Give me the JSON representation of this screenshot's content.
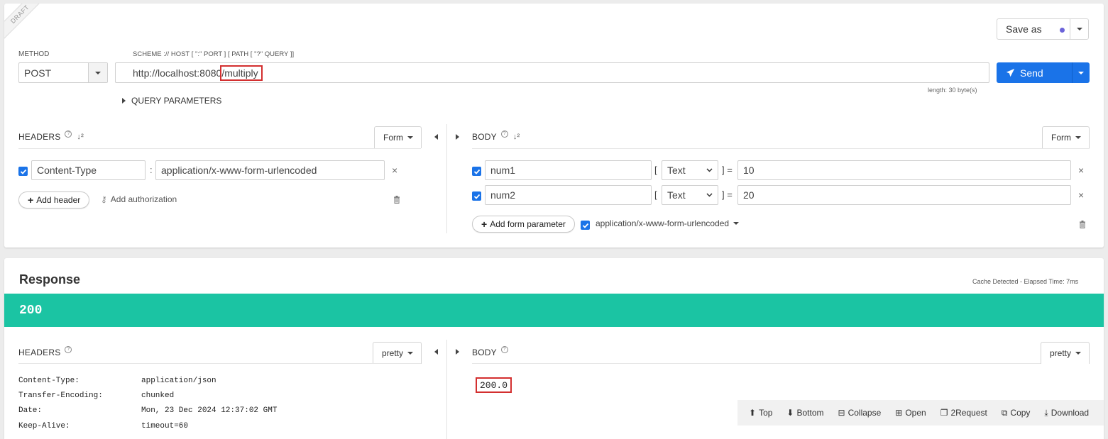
{
  "request": {
    "draft_label": "DRAFT",
    "save_as_label": "Save as",
    "method_label": "METHOD",
    "method_value": "POST",
    "url_hint": "SCHEME :// HOST [ \":\" PORT ] [ PATH [ \"?\" QUERY ]]",
    "url_prefix": "http://localhost:8080",
    "url_path": "/multiply",
    "send_label": "Send",
    "length_text": "length: 30 byte(s)",
    "query_params_label": "QUERY PARAMETERS",
    "headers": {
      "title": "HEADERS",
      "mode_label": "Form",
      "rows": [
        {
          "key": "Content-Type",
          "value": "application/x-www-form-urlencoded"
        }
      ],
      "add_header_label": "Add header",
      "add_auth_label": "Add authorization"
    },
    "body": {
      "title": "BODY",
      "mode_label": "Form",
      "rows": [
        {
          "name": "num1",
          "type": "Text",
          "value": "10"
        },
        {
          "name": "num2",
          "type": "Text",
          "value": "20"
        }
      ],
      "add_param_label": "Add form parameter",
      "content_type": "application/x-www-form-urlencoded"
    }
  },
  "response": {
    "title": "Response",
    "meta": "Cache Detected - Elapsed Time: 7ms",
    "status": "200",
    "status_color": "#1bc4a3",
    "headers": {
      "title": "HEADERS",
      "mode_label": "pretty",
      "rows": [
        {
          "key": "Content-Type:",
          "value": "application/json"
        },
        {
          "key": "Transfer-Encoding:",
          "value": "chunked"
        },
        {
          "key": "Date:",
          "value": "Mon, 23 Dec 2024 12:37:02 GMT"
        },
        {
          "key": "Keep-Alive:",
          "value": "timeout=60"
        }
      ]
    },
    "body": {
      "title": "BODY",
      "mode_label": "pretty",
      "content": "200.0"
    },
    "toolbar": {
      "top": "Top",
      "bottom": "Bottom",
      "collapse": "Collapse",
      "open": "Open",
      "to_request": "2Request",
      "copy": "Copy",
      "download": "Download"
    }
  },
  "colors": {
    "accent": "#1a73e8",
    "send": "#1a73e8",
    "highlight": "#d32f2f"
  }
}
